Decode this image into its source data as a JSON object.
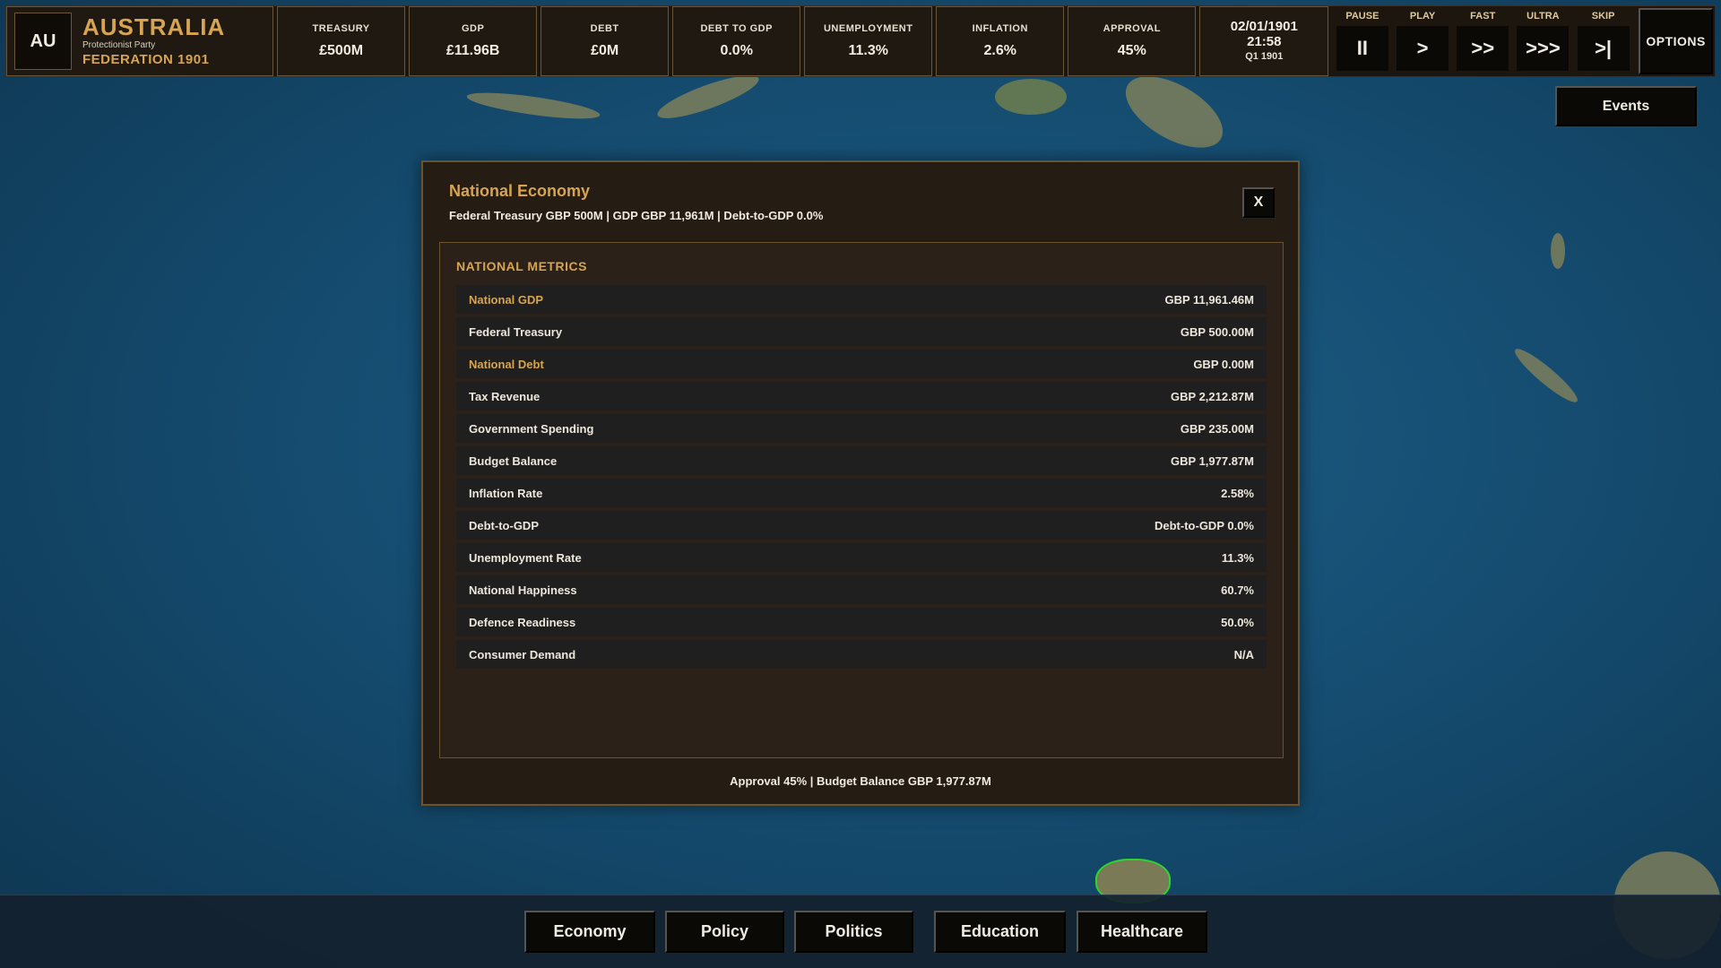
{
  "country": {
    "code": "AU",
    "name": "AUSTRALIA",
    "party": "Protectionist Party",
    "era": "FEDERATION 1901"
  },
  "stats": [
    {
      "label": "TREASURY",
      "value": "£500M"
    },
    {
      "label": "GDP",
      "value": "£11.96B"
    },
    {
      "label": "DEBT",
      "value": "£0M"
    },
    {
      "label": "DEBT TO GDP",
      "value": "0.0%"
    },
    {
      "label": "UNEMPLOYMENT",
      "value": "11.3%"
    },
    {
      "label": "INFLATION",
      "value": "2.6%"
    },
    {
      "label": "APPROVAL",
      "value": "45%"
    }
  ],
  "datetime": {
    "date": "02/01/1901",
    "time": "21:58",
    "quarter": "Q1 1901"
  },
  "speed_controls": [
    {
      "label": "PAUSE",
      "symbol": "II"
    },
    {
      "label": "PLAY",
      "symbol": ">"
    },
    {
      "label": "FAST",
      "symbol": ">>"
    },
    {
      "label": "ULTRA",
      "symbol": ">>>"
    },
    {
      "label": "SKIP",
      "symbol": ">|"
    }
  ],
  "options_label": "OPTIONS",
  "events_label": "Events",
  "modal": {
    "title": "National Economy",
    "subtitle": "Federal Treasury GBP 500M | GDP GBP 11,961M | Debt-to-GDP 0.0%",
    "close_label": "X",
    "metrics_heading": "NATIONAL METRICS",
    "metrics": [
      {
        "label": "National GDP",
        "value": "GBP 11,961.46M",
        "highlight": true
      },
      {
        "label": "Federal Treasury",
        "value": "GBP 500.00M",
        "highlight": false
      },
      {
        "label": "National Debt",
        "value": "GBP 0.00M",
        "highlight": true
      },
      {
        "label": "Tax Revenue",
        "value": "GBP 2,212.87M",
        "highlight": false
      },
      {
        "label": "Government Spending",
        "value": "GBP 235.00M",
        "highlight": false
      },
      {
        "label": "Budget Balance",
        "value": "GBP 1,977.87M",
        "highlight": false
      },
      {
        "label": "Inflation Rate",
        "value": "2.58%",
        "highlight": false
      },
      {
        "label": "Debt-to-GDP",
        "value": "Debt-to-GDP 0.0%",
        "highlight": false
      },
      {
        "label": "Unemployment Rate",
        "value": "11.3%",
        "highlight": false
      },
      {
        "label": "National Happiness",
        "value": "60.7%",
        "highlight": false
      },
      {
        "label": "Defence Readiness",
        "value": "50.0%",
        "highlight": false
      },
      {
        "label": "Consumer Demand",
        "value": "N/A",
        "highlight": false
      }
    ],
    "footer": "Approval 45% | Budget Balance GBP 1,977.87M"
  },
  "bottom_nav": [
    {
      "label": "Economy"
    },
    {
      "label": "Policy"
    },
    {
      "label": "Politics"
    },
    {
      "label": "Education"
    },
    {
      "label": "Healthcare"
    }
  ],
  "colors": {
    "accent_gold": "#d6a452",
    "panel_bg": "#251c13",
    "ocean": "#1a5a80",
    "coast_highlight": "#2dd62d"
  }
}
